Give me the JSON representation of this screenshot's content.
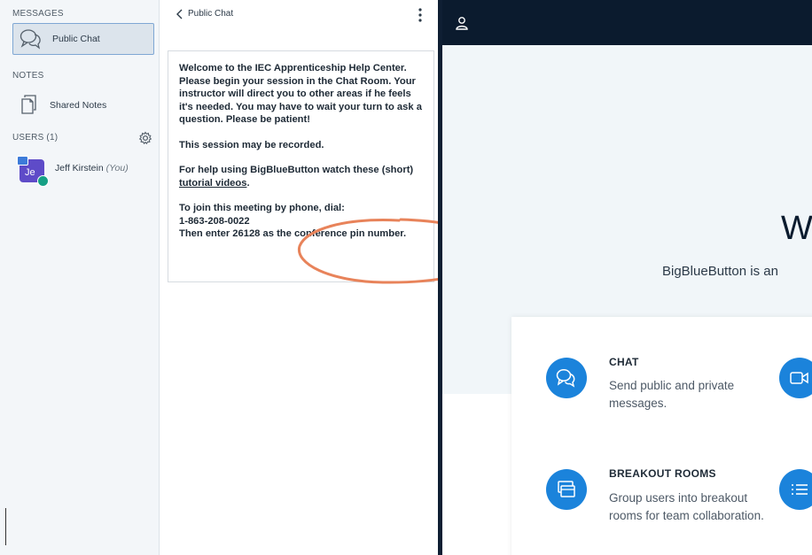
{
  "sidebar": {
    "messages_title": "MESSAGES",
    "public_chat_label": "Public Chat",
    "notes_title": "NOTES",
    "shared_notes_label": "Shared Notes",
    "users_title": "USERS (1)",
    "user": {
      "initials": "Je",
      "name": "Jeff Kirstein",
      "you_tag": "(You)"
    }
  },
  "chat": {
    "title": "Public Chat",
    "welcome": {
      "p1": "Welcome to the IEC Apprenticeship Help Center. Please begin your session in the Chat Room. Your instructor will direct you to other areas if he feels it's needed. You may have to wait your turn to ask a question. Please be patient!",
      "p2": "This session may be recorded.",
      "p3_before": "For help using BigBlueButton watch these (short)",
      "p3_link": "tutorial videos",
      "p3_after": ".",
      "p4_line1": "To join this meeting by phone, dial:",
      "p4_line2": "1-863-208-0022",
      "p4_line3": "Then enter 26128 as the conference pin number."
    }
  },
  "main": {
    "big_text": "W",
    "tagline": "BigBlueButton is an",
    "features": [
      {
        "icon": "chat-bubbles-icon",
        "title": "CHAT",
        "desc": "Send public and private messages."
      },
      {
        "icon": "breakout-rooms-icon",
        "title": "BREAKOUT ROOMS",
        "desc": "Group users into breakout rooms for team collaboration."
      }
    ]
  },
  "colors": {
    "accent": "#1b83db",
    "topbar": "#0b1b2e",
    "highlight_ellipse": "#e8835a",
    "avatar": "#5e4bc8"
  }
}
